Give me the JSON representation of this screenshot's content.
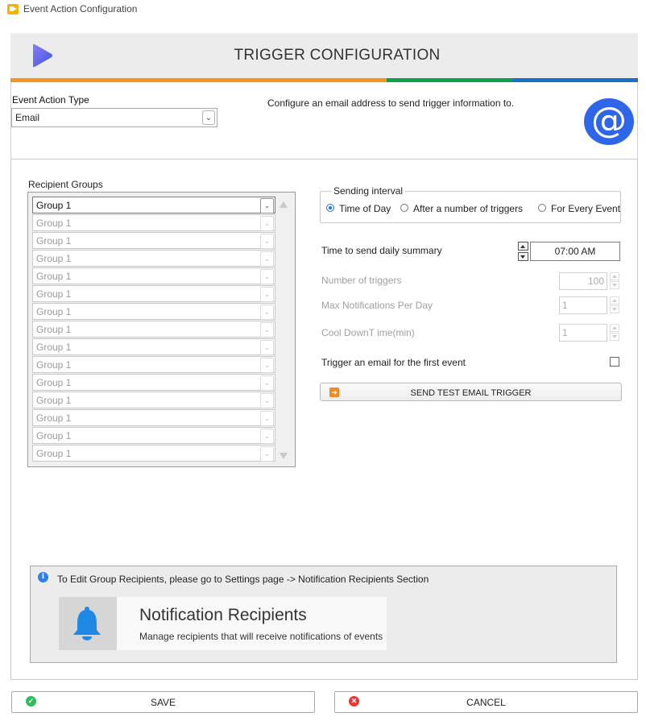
{
  "window": {
    "title": "Event Action Configuration"
  },
  "header": {
    "title": "TRIGGER CONFIGURATION",
    "strip_colors": [
      "#f7941d",
      "#f7941d",
      "#f7941d",
      "#0fa14b",
      "#1a6fc4"
    ]
  },
  "event_action": {
    "label": "Event Action Type",
    "value": "Email",
    "description": "Configure an email address to send trigger information to.",
    "icon": "@"
  },
  "recipients": {
    "label": "Recipient Groups",
    "groups": [
      "Group 1",
      "Group 1",
      "Group 1",
      "Group 1",
      "Group 1",
      "Group 1",
      "Group 1",
      "Group 1",
      "Group 1",
      "Group 1",
      "Group 1",
      "Group 1",
      "Group 1",
      "Group 1",
      "Group 1"
    ]
  },
  "sending_interval": {
    "label": "Sending interval",
    "options": [
      "Time of Day",
      "After a number of triggers",
      "For Every Event"
    ],
    "selected": "Time of Day"
  },
  "fields": {
    "daily_summary_label": "Time to send daily summary",
    "daily_summary_value": "07:00 AM",
    "num_triggers_label": "Number of triggers",
    "num_triggers_value": "100",
    "max_notif_label": "Max Notifications Per Day",
    "max_notif_value": "1",
    "cooldown_label": "Cool DownT ime(min)",
    "cooldown_value": "1",
    "first_event_label": "Trigger an email for the first event",
    "first_event_checked": false,
    "test_button_label": "SEND TEST EMAIL TRIGGER"
  },
  "info": {
    "text": "To Edit Group Recipients, please go to Settings page -> Notification Recipients Section",
    "card_title": "Notification Recipients",
    "card_subtitle": "Manage recipients that will receive notifications of events"
  },
  "footer": {
    "save_label": "SAVE",
    "cancel_label": "CANCEL"
  },
  "colors": {
    "accent": "#2f66e9",
    "bell": "#1e88e5",
    "save": "#2ebd59",
    "cancel": "#e53935"
  }
}
